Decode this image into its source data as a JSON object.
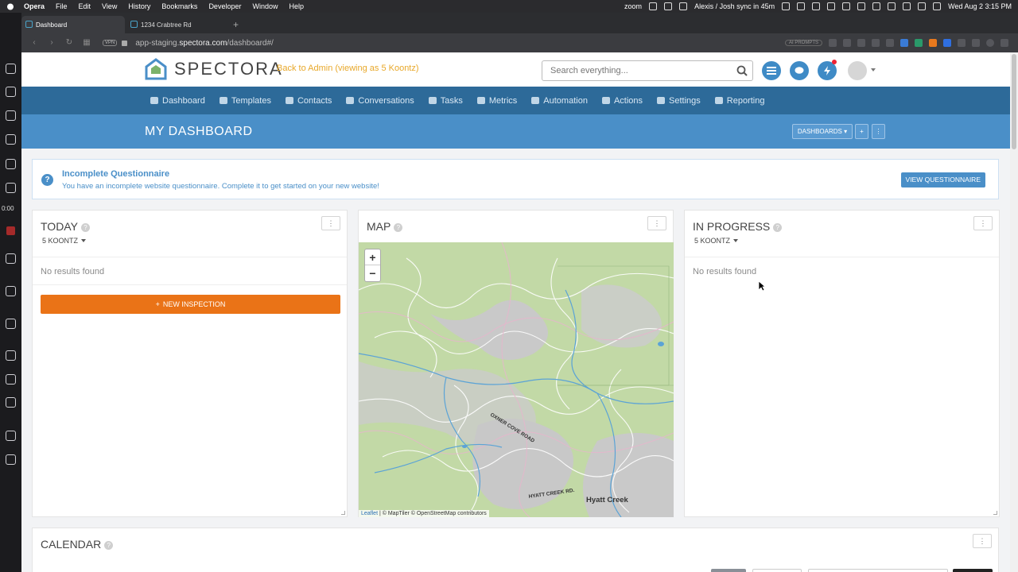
{
  "menubar": {
    "items": [
      "Opera",
      "File",
      "Edit",
      "View",
      "History",
      "Bookmarks",
      "Developer",
      "Window",
      "Help"
    ],
    "zoom_label": "zoom",
    "meeting": "Alexis / Josh sync in 45m",
    "datetime": "Wed Aug 2  3:15 PM"
  },
  "sidebar": {
    "timer": "0:00"
  },
  "tabs": [
    {
      "label": "Dashboard",
      "active": true
    },
    {
      "label": "1234 Crabtree Rd",
      "active": false
    }
  ],
  "address": {
    "vpn": "VPN",
    "url_prefix": "app-staging.",
    "url_domain": "spectora.com",
    "url_path": "/dashboard#/",
    "ai_prompts": "AI PROMPTS"
  },
  "header": {
    "brand": "SPECTORA",
    "back_to_admin": "Back to Admin (viewing as 5 Koontz)",
    "search_placeholder": "Search everything...",
    "brand_color": "#4a8fc8",
    "accent_color": "#ea7317"
  },
  "nav": {
    "items": [
      "Dashboard",
      "Templates",
      "Contacts",
      "Conversations",
      "Tasks",
      "Metrics",
      "Automation",
      "Actions",
      "Settings",
      "Reporting"
    ]
  },
  "dashboard": {
    "title": "MY DASHBOARD",
    "dashboards_btn": "DASHBOARDS",
    "add_btn": "+",
    "more_btn": "⋮"
  },
  "alert": {
    "title": "Incomplete Questionnaire",
    "body": "You have an incomplete website questionnaire. Complete it to get started on your new website!",
    "button": "VIEW QUESTIONNAIRE"
  },
  "cards": {
    "today": {
      "title": "TODAY",
      "filter": "5 KOONTZ",
      "empty": "No results found",
      "action": "NEW INSPECTION"
    },
    "map": {
      "title": "MAP",
      "zoom_in": "+",
      "zoom_out": "−",
      "label_road1": "OXNER COVE ROAD",
      "label_road2": "HYATT CREEK RD.",
      "label_place": "Hyatt Creek",
      "attrib_leaflet": "Leaflet",
      "attrib_rest": " | © MapTiler © OpenStreetMap contributors"
    },
    "in_progress": {
      "title": "IN PROGRESS",
      "filter": "5 KOONTZ",
      "empty": "No results found"
    },
    "calendar": {
      "title": "CALENDAR"
    }
  }
}
